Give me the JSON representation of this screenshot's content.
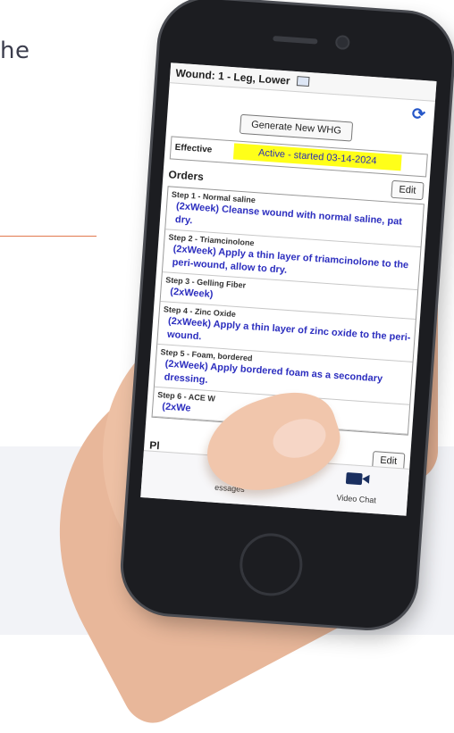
{
  "page_fragment": "he",
  "screen": {
    "wound_header": "Wound: 1 - Leg, Lower",
    "generate_button_label": "Generate New WHG",
    "effective": {
      "label": "Effective",
      "value": "Active - started 03-14-2024",
      "highlight_color": "#ffff19"
    },
    "orders": {
      "label": "Orders",
      "edit_label": "Edit",
      "items": [
        {
          "step": "Step 1 - Normal saline",
          "instruction": "(2xWeek) Cleanse wound with normal saline, pat dry."
        },
        {
          "step": "Step 2 - Triamcinolone",
          "instruction": "(2xWeek) Apply a thin layer of triamcinolone to the peri-wound, allow to dry."
        },
        {
          "step": "Step 3 - Gelling Fiber",
          "instruction": "(2xWeek)"
        },
        {
          "step": "Step 4 - Zinc Oxide",
          "instruction": "(2xWeek) Apply a thin layer of zinc oxide to the peri-wound."
        },
        {
          "step": "Step 5 - Foam, bordered",
          "instruction": "(2xWeek) Apply bordered foam as a secondary dressing."
        },
        {
          "step": "Step 6 - ACE W",
          "instruction": "(2xWe"
        }
      ]
    },
    "second_section": {
      "label": "Pl",
      "edit_label": "Edit"
    },
    "tab_bar": {
      "messages_label": "essages",
      "video_chat_label": "Video Chat"
    }
  },
  "colors": {
    "instruction_text": "#2c2ebf",
    "accent_blue": "#2456c8",
    "divider": "#e2794f"
  }
}
